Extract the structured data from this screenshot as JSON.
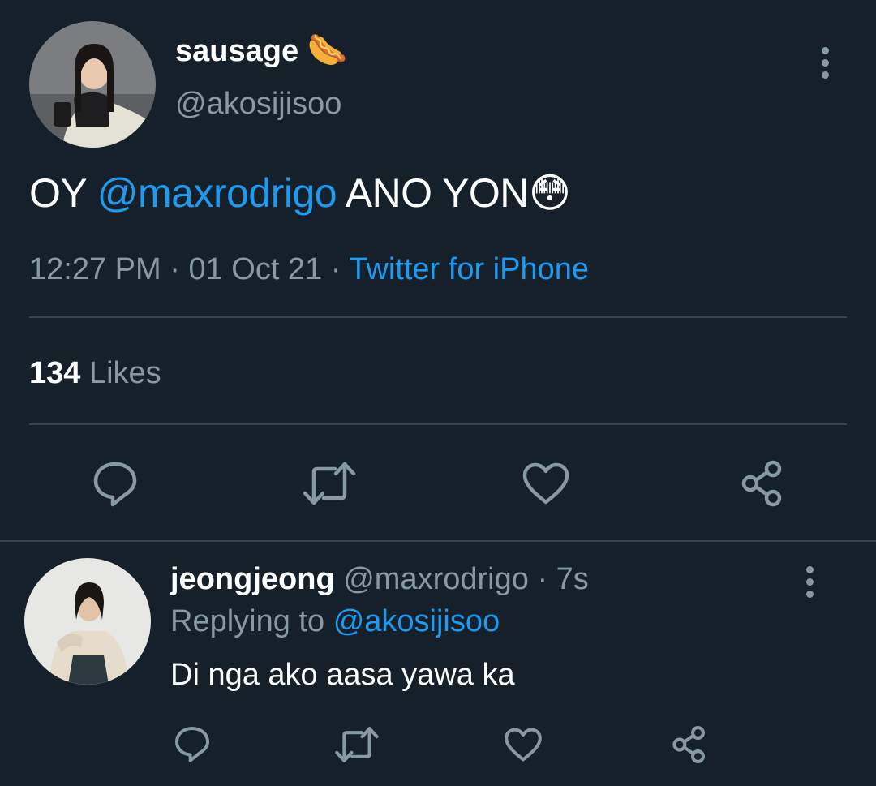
{
  "main_tweet": {
    "display_name": "sausage",
    "name_emoji": "🌭",
    "handle": "@akosijisoo",
    "text_prefix": "OY ",
    "mention": "@maxrodrigo",
    "text_suffix": " ANO YON",
    "text_emoji": "😳",
    "time": "12:27 PM",
    "separator": " · ",
    "date": "01 Oct 21",
    "source": "Twitter for iPhone",
    "likes_count": "134",
    "likes_label": "Likes"
  },
  "reply": {
    "display_name": "jeongjeong",
    "handle": "@maxrodrigo",
    "age": "· 7s",
    "replying_label": "Replying to",
    "replying_to": "@akosijisoo",
    "text": "Di nga ako aasa yawa ka"
  },
  "icons": {
    "reply": "reply-bubble-icon",
    "retweet": "retweet-icon",
    "like": "heart-icon",
    "share": "share-icon",
    "more": "more-vertical-icon"
  },
  "colors": {
    "background": "#15202b",
    "text": "#ffffff",
    "muted": "#8899a6",
    "link": "#1d9bf0",
    "divider": "#38444d"
  }
}
